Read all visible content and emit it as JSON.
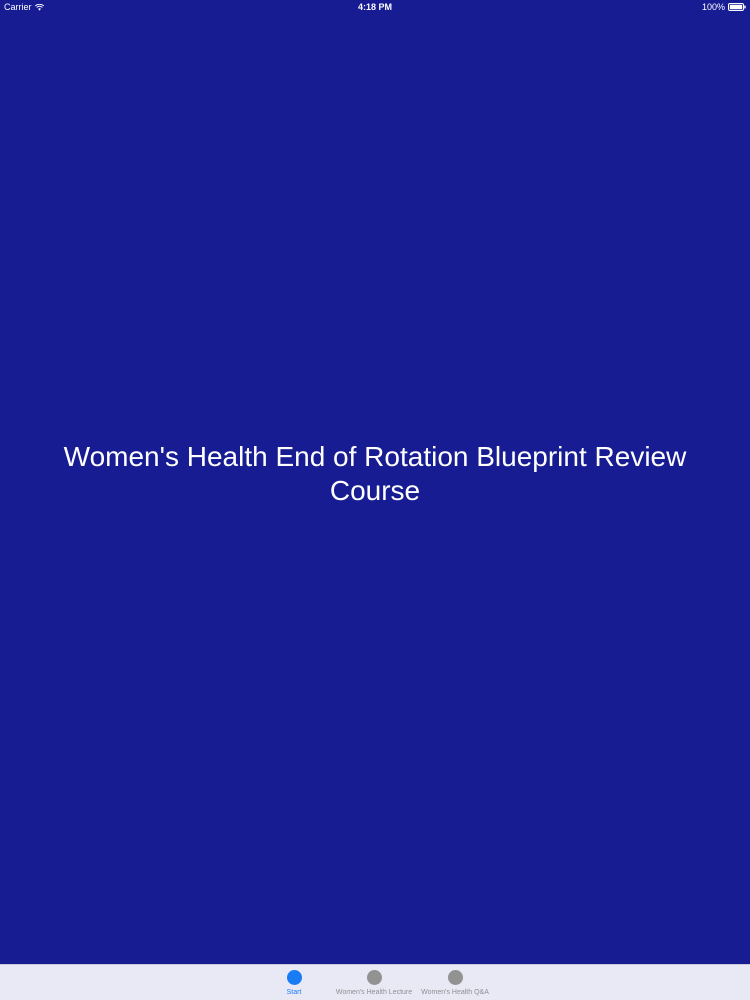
{
  "status_bar": {
    "carrier": "Carrier",
    "time": "4:18 PM",
    "battery": "100%",
    "wifi_icon": "wifi-icon",
    "battery_icon": "battery-full-icon"
  },
  "main": {
    "title": "Women's Health End of Rotation Blueprint Review Course",
    "background_color": "#171c93"
  },
  "tab_bar": {
    "active_color": "#1a7cf5",
    "inactive_color": "#929292",
    "tabs": [
      {
        "label": "Start",
        "icon": "circle-icon",
        "active": true
      },
      {
        "label": "Women's Health Lecture",
        "icon": "circle-icon",
        "active": false
      },
      {
        "label": "Women's Health Q&A",
        "icon": "circle-icon",
        "active": false
      }
    ]
  }
}
